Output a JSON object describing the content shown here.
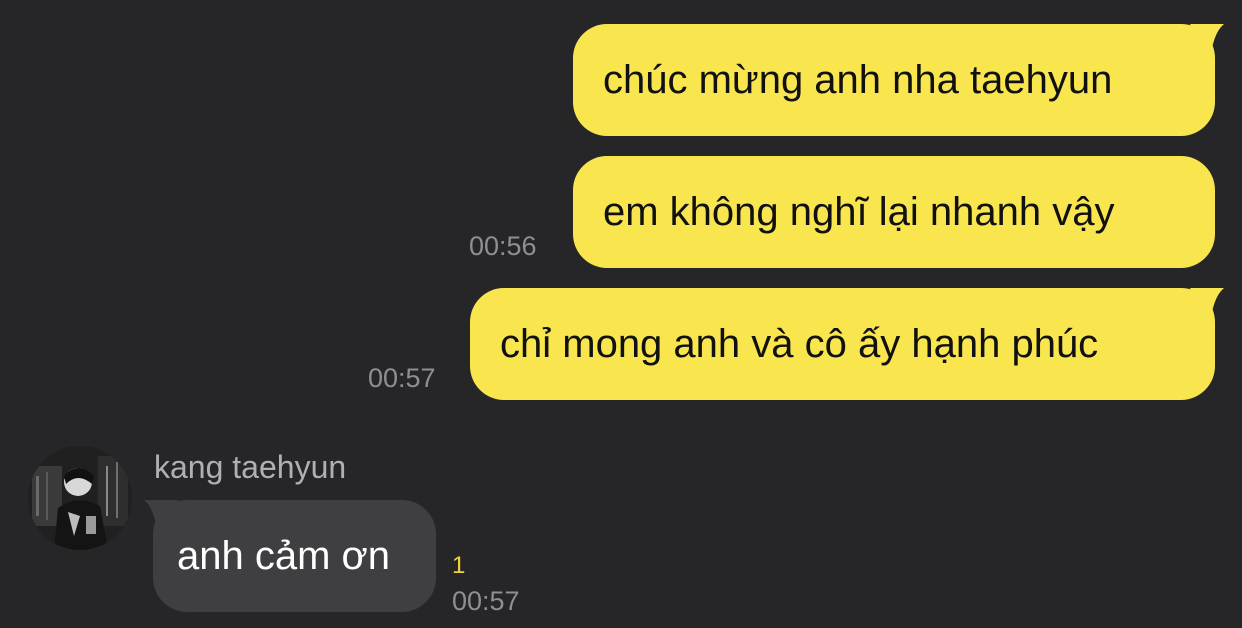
{
  "chat": {
    "outgoing": [
      {
        "text": "chúc mừng anh nha taehyun"
      },
      {
        "text": "em không nghĩ lại nhanh vậy",
        "time": "00:56"
      },
      {
        "text": "chỉ mong anh và cô ấy hạnh phúc",
        "time": "00:57"
      }
    ],
    "incoming": {
      "sender": "kang taehyun",
      "avatar_icon": "profile-photo-avatar",
      "text": "anh cảm ơn",
      "unread_count": "1",
      "time": "00:57"
    }
  },
  "colors": {
    "background": "#262628",
    "outgoing_bubble": "#f9e54e",
    "incoming_bubble": "#3f3f42",
    "timestamp": "#8e8e93",
    "unread": "#f0d43a"
  }
}
